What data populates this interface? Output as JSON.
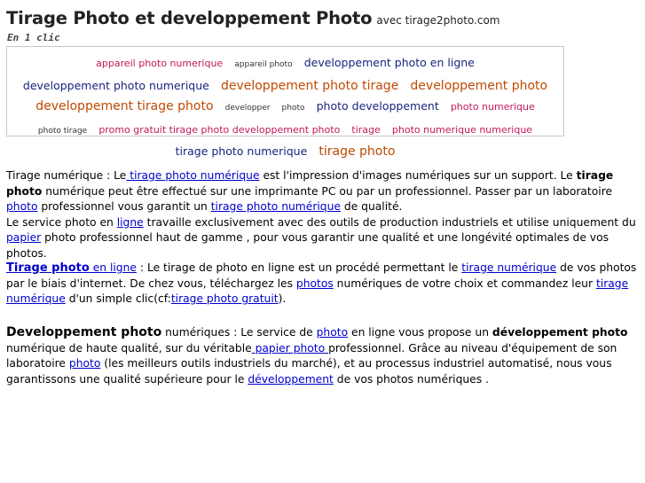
{
  "header": {
    "title": "Tirage Photo et developpement Photo",
    "title_suffix": "avec tirage2photo.com",
    "subtitle": "En 1 clic"
  },
  "tag_cloud": [
    {
      "text": "appareil photo numerique",
      "size": 11,
      "color": "#c2185b"
    },
    {
      "text": "appareil photo",
      "size": 9,
      "color": "#333333"
    },
    {
      "text": "developpement photo en ligne",
      "size": 12.5,
      "color": "#1a237e"
    },
    {
      "text": "developpement photo numerique",
      "size": 12.5,
      "color": "#1a237e"
    },
    {
      "text": "developpement photo tirage",
      "size": 14,
      "color": "#c04a00"
    },
    {
      "text": "developpement photo",
      "size": 14,
      "color": "#c04a00"
    },
    {
      "text": "developpement tirage photo",
      "size": 14,
      "color": "#c04a00"
    },
    {
      "text": "developper",
      "size": 9,
      "color": "#333333"
    },
    {
      "text": "photo",
      "size": 9,
      "color": "#333333"
    },
    {
      "text": "photo developpement",
      "size": 12.5,
      "color": "#1a237e"
    },
    {
      "text": "photo numerique",
      "size": 11,
      "color": "#c2185b"
    },
    {
      "text": "photo tirage",
      "size": 9,
      "color": "#333333"
    },
    {
      "text": "promo gratuit tirage photo developpement photo",
      "size": 11,
      "color": "#c2185b"
    },
    {
      "text": "tirage",
      "size": 11,
      "color": "#c2185b"
    },
    {
      "text": "photo numerique numerique",
      "size": 11,
      "color": "#c2185b"
    },
    {
      "text": "tirage photo numerique",
      "size": 12.5,
      "color": "#1a237e"
    },
    {
      "text": "tirage photo",
      "size": 14,
      "color": "#c04a00"
    }
  ],
  "p1": {
    "t1": " Tirage numérique :  Le",
    "l1": " tirage photo numérique",
    "t2": " est l'impression d'images numériques sur un support. Le ",
    "b1": "tirage photo",
    "t3": " numérique peut être effectué sur une imprimante PC ou par un professionnel. Passer par un laboratoire ",
    "l2": "photo",
    "t4": " professionnel vous garantit un ",
    "l3": "tirage photo numérique",
    "t5": " de qualité.",
    "t6": " Le service photo en ",
    "l4": "ligne",
    "t7": " travaille exclusivement avec des outils de production industriels et utilise uniquement du ",
    "l5": "papier",
    "t8": " photo professionnel haut de gamme , pour vous garantir une qualité et une longévité optimales de vos photos."
  },
  "p2": {
    "l1": "Tirage photo",
    "l2": " en ligne",
    "t1": " : Le tirage de photo en ligne est un procédé permettant le ",
    "l3": "tirage numérique",
    "t2": " de vos photos par le biais d'internet. De chez vous, téléchargez les ",
    "l4": "photos",
    "t3": " numériques de votre choix et commandez leur ",
    "l5": "tirage numérique",
    "t4": " d'un simple clic(cf:",
    "l6": "tirage photo gratuit",
    "t5": ")."
  },
  "p3": {
    "b1": "Developpement photo",
    "t1": " numériques : Le service de ",
    "l1": "photo",
    "t2": " en ligne vous propose un ",
    "b2": "développement photo",
    "t3": " numérique de haute qualité, sur du véritable",
    "l2": " papier photo ",
    "t4": "professionnel. Grâce au niveau d'équipement de son laboratoire ",
    "l3": "photo",
    "t5": " (les meilleurs outils industriels du marché), et au processus industriel automatisé, nous vous garantissons une qualité supérieure pour le ",
    "l4": "développement",
    "t6": " de vos photos numériques ."
  }
}
